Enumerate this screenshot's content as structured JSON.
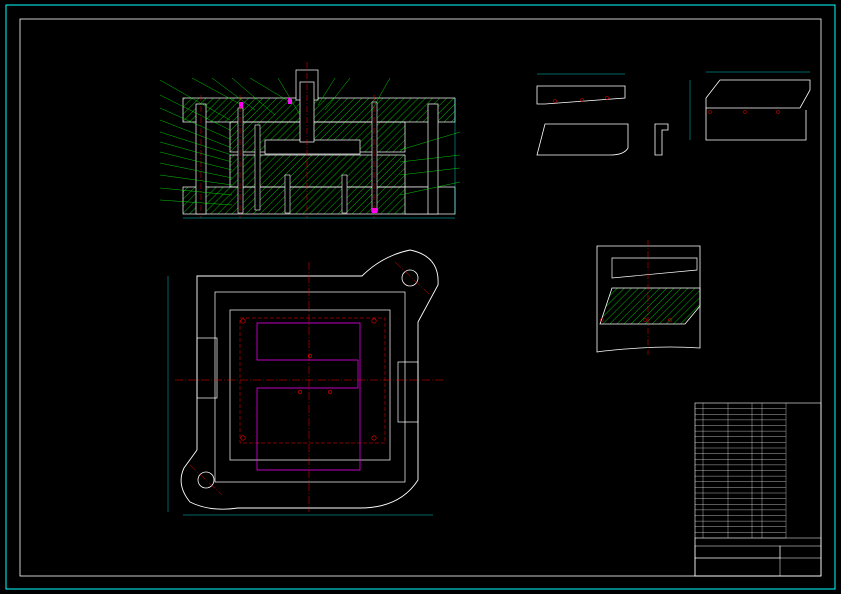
{
  "view_titles": {
    "top_right": "",
    "right_upper": "",
    "right_middle": ""
  },
  "notes": {
    "title": "",
    "lines": [
      "",
      "",
      "",
      "",
      "",
      "",
      "",
      ""
    ]
  },
  "title_block": {
    "rows": 24
  },
  "colors": {
    "frame": "#00ffff",
    "outline": "#ffffff",
    "center": "#ff0000",
    "hatch": "#00ff00",
    "dim": "#00ffff",
    "magenta": "#ff00ff",
    "yellow": "#ffff00"
  }
}
